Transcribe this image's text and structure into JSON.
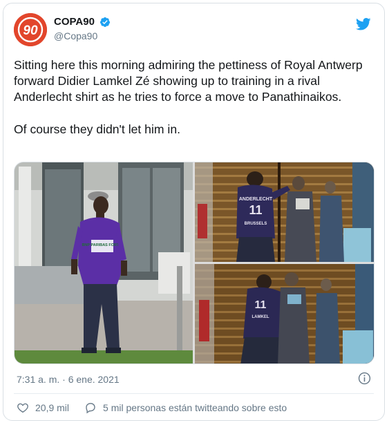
{
  "account": {
    "display_name": "COPA90",
    "handle": "@Copa90",
    "avatar_text": "90",
    "verified": true
  },
  "tweet": {
    "paragraphs": [
      "Sitting here this morning admiring the pettiness of Royal Antwerp forward Didier Lamkel Zé showing up to training in a rival Anderlecht shirt as he tries to force a move to Panathinaikos.",
      "Of course they didn't let him in."
    ],
    "photo_texts": {
      "left_shirt_sponsor": "BNP PARIBAS FORTIS",
      "tr_shirt_name": "ANDERLECHT",
      "tr_shirt_number": "11",
      "tr_shirt_back": "BRUSSELS",
      "br_shirt_number": "11",
      "br_shirt_name": "LAMKEL"
    }
  },
  "meta": {
    "timestamp": "7:31 a. m. · 6 ene. 2021"
  },
  "engagement": {
    "likes": "20,9 mil",
    "conversation": "5 mil personas están twitteando sobre esto"
  },
  "icons": {
    "brand": "twitter-bird-icon",
    "verified": "verified-badge-icon",
    "info": "info-icon",
    "like": "heart-icon",
    "reply": "speech-bubble-icon"
  },
  "colors": {
    "brand_blue": "#1da1f2",
    "avatar_red": "#e2462c",
    "text": "#14171a",
    "secondary_text": "#657786",
    "border": "#d9dfe4"
  }
}
